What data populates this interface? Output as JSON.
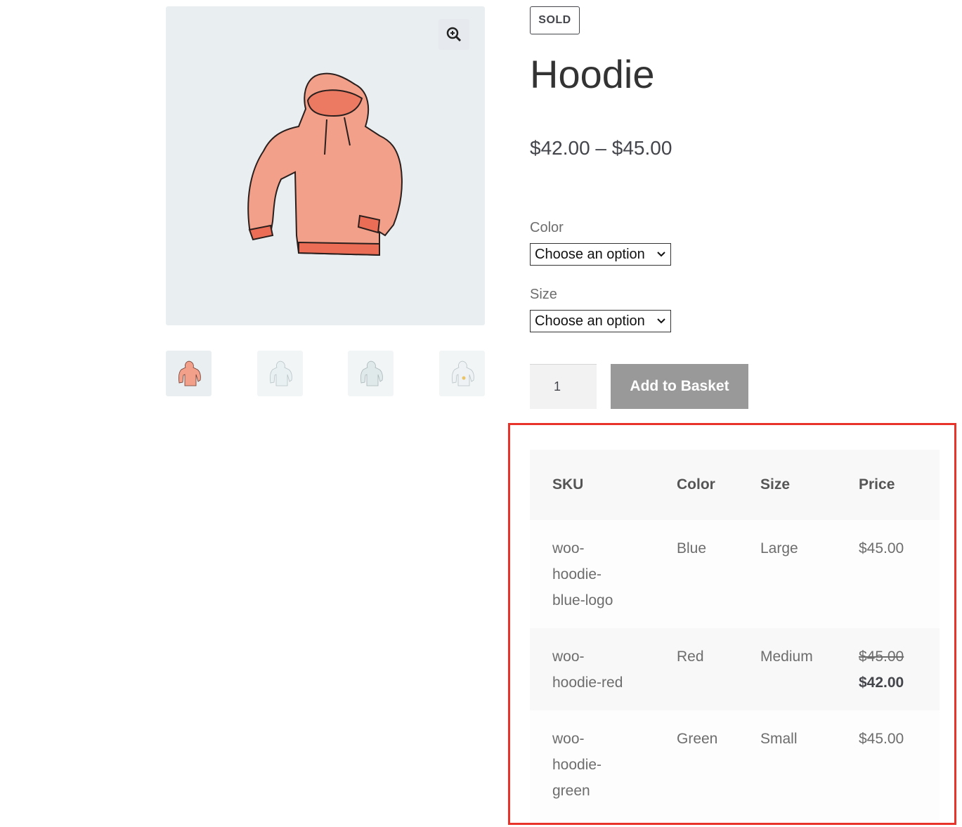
{
  "product": {
    "badge": "SOLD",
    "title": "Hoodie",
    "price_range": "$42.00 – $45.00",
    "image_bg": "#e9eef1",
    "thumbnails": [
      "hoodie-red-thumbnail",
      "hoodie-blue-thumbnail",
      "hoodie-green-thumbnail",
      "hoodie-logo-thumbnail"
    ]
  },
  "form": {
    "color_label": "Color",
    "color_select": "Choose an option",
    "size_label": "Size",
    "size_select": "Choose an option",
    "quantity": "1",
    "add_button": "Add to Basket"
  },
  "variations_table": {
    "headers": [
      "SKU",
      "Color",
      "Size",
      "Price"
    ],
    "rows": [
      {
        "sku": [
          "woo-",
          "hoodie-",
          "blue-logo"
        ],
        "color": "Blue",
        "size": "Large",
        "price": "$45.00"
      },
      {
        "sku": [
          "woo-",
          "hoodie-red"
        ],
        "color": "Red",
        "size": "Medium",
        "price_old": "$45.00",
        "price_sale": "$42.00"
      },
      {
        "sku": [
          "woo-",
          "hoodie-",
          "green"
        ],
        "color": "Green",
        "size": "Small",
        "price": "$45.00"
      }
    ],
    "highlight_color": "#e8332a"
  }
}
